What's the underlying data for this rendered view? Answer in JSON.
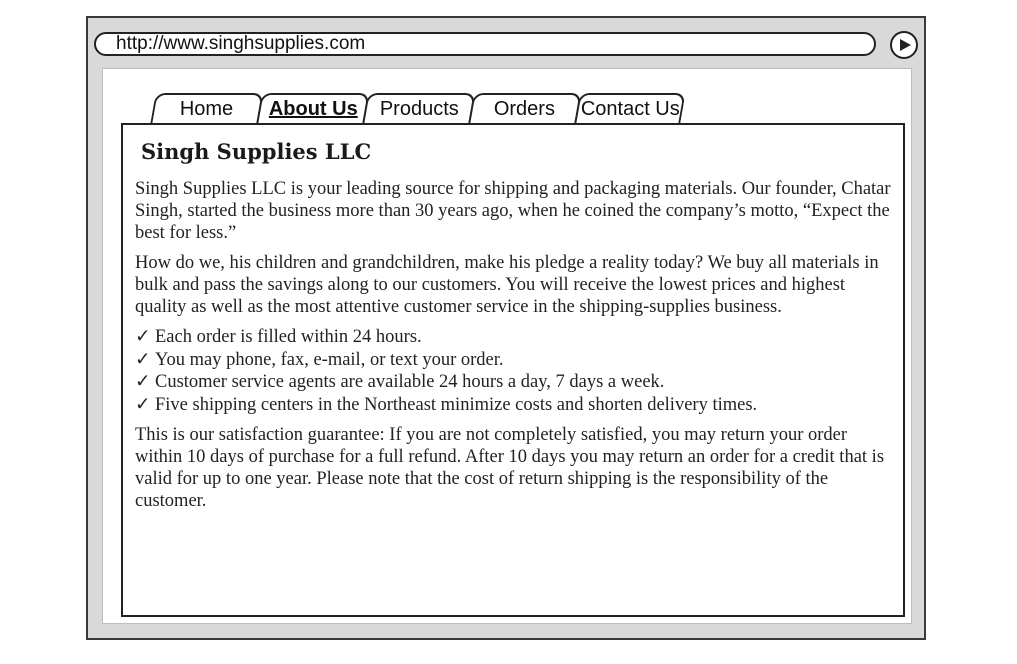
{
  "browser": {
    "url": "http://www.singhsupplies.com",
    "go_icon": "play-circle-icon"
  },
  "tabs": [
    {
      "label": "Home",
      "active": false
    },
    {
      "label": "About Us",
      "active": true
    },
    {
      "label": "Products",
      "active": false
    },
    {
      "label": "Orders",
      "active": false
    },
    {
      "label": "Contact Us",
      "active": false
    }
  ],
  "content": {
    "title": "Singh Supplies LLC",
    "paragraph1": "Singh Supplies LLC is your leading source for shipping and packaging materials. Our founder, Chatar Singh, started the business more than 30 years ago, when he coined the company’s motto, “Expect the best for less.”",
    "paragraph2": "How do we, his children and grandchildren, make his pledge a reality today? We buy all materials in bulk and pass the savings along to our customers. You will receive the lowest prices and highest quality as well as the most attentive customer service in the shipping-supplies business.",
    "checklist": [
      "Each order is filled within 24 hours.",
      "You may phone, fax, e-mail, or text your order.",
      "Customer service agents are available 24 hours a day, 7 days a week.",
      "Five shipping centers in the Northeast minimize costs and shorten delivery times."
    ],
    "check_mark": "✓",
    "paragraph3": "This is our satisfaction guarantee: If you are not completely satisfied, you may return your order within 10 days of purchase for a full refund. After 10 days you may return an order for a credit that is valid for up to one year. Please note that the cost of return shipping is the responsibility of the customer."
  }
}
